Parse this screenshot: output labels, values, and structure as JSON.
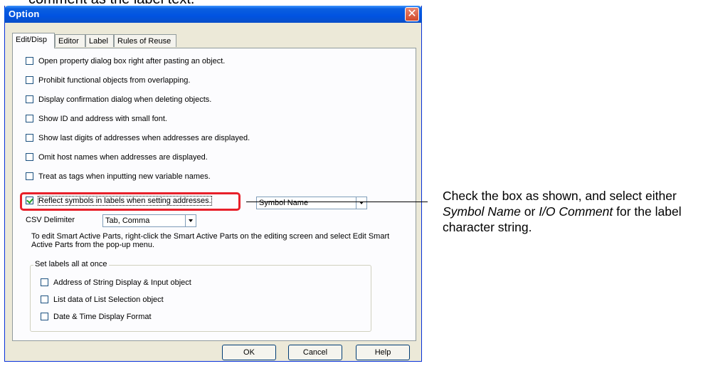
{
  "top_caption": "comment as the label text.",
  "dialog": {
    "title": "Option",
    "close_glyph": "✕",
    "tabs": [
      "Edit/Disp",
      "Editor",
      "Label",
      "Rules of Reuse"
    ],
    "options": [
      {
        "label": "Open property dialog box right after pasting an object.",
        "checked": false
      },
      {
        "label": "Prohibit functional objects from overlapping.",
        "checked": false
      },
      {
        "label": "Display confirmation dialog when deleting objects.",
        "checked": false
      },
      {
        "label": "Show ID and address with small font.",
        "checked": false
      },
      {
        "label": "Show last digits of addresses when addresses are displayed.",
        "checked": false
      },
      {
        "label": "Omit host names when addresses are displayed.",
        "checked": false
      },
      {
        "label": "Treat as tags when inputting new variable names.",
        "checked": false
      },
      {
        "label": "Reflect symbols in labels when setting addresses.",
        "checked": true
      }
    ],
    "label_source_select": "Symbol Name",
    "csv_delimiter_label": "CSV Delimiter",
    "csv_delimiter_value": "Tab, Comma",
    "info_text": "To edit Smart Active Parts, right-click the Smart Active Parts on the editing screen and select Edit Smart Active Parts from the pop-up menu.",
    "set_labels_group": {
      "title": "Set labels all at once",
      "items": [
        {
          "label": "Address of String Display & Input object",
          "checked": false
        },
        {
          "label": "List data of List Selection object",
          "checked": false
        },
        {
          "label": "Date & Time Display Format",
          "checked": false
        }
      ]
    },
    "buttons": {
      "ok": "OK",
      "cancel": "Cancel",
      "help": "Help"
    }
  },
  "callout": {
    "part1": "Check the box as shown, and select either ",
    "em1": "Symbol Name",
    "part2": " or ",
    "em2": "I/O Comment",
    "part3": " for the label character string."
  }
}
